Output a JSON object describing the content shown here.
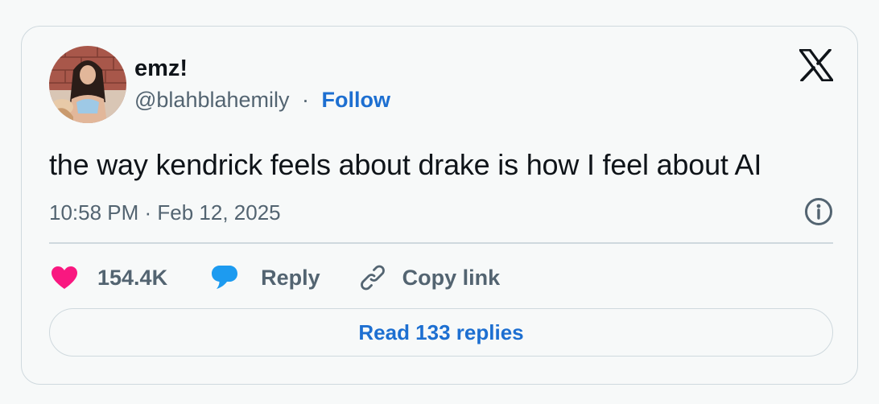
{
  "author": {
    "name": "emz!",
    "handle": "@blahblahemily",
    "separator": "·",
    "follow_label": "Follow"
  },
  "tweet": {
    "text": "the way kendrick feels about drake is how I feel about AI",
    "timestamp": "10:58 PM · Feb 12, 2025"
  },
  "actions": {
    "likes_count": "154.4K",
    "reply_label": "Reply",
    "copy_link_label": "Copy link"
  },
  "read_replies_label": "Read 133 replies",
  "icons": {
    "logo": "x-logo-icon",
    "info": "info-icon",
    "like": "heart-icon",
    "reply": "speech-bubble-icon",
    "copy": "link-icon"
  },
  "colors": {
    "background": "#f7f9f9",
    "border": "#cfd9de",
    "text": "#0f1419",
    "secondary_text": "#536471",
    "link": "#1d6fd1",
    "heart": "#f91880",
    "reply_bubble": "#1d9bf0"
  }
}
